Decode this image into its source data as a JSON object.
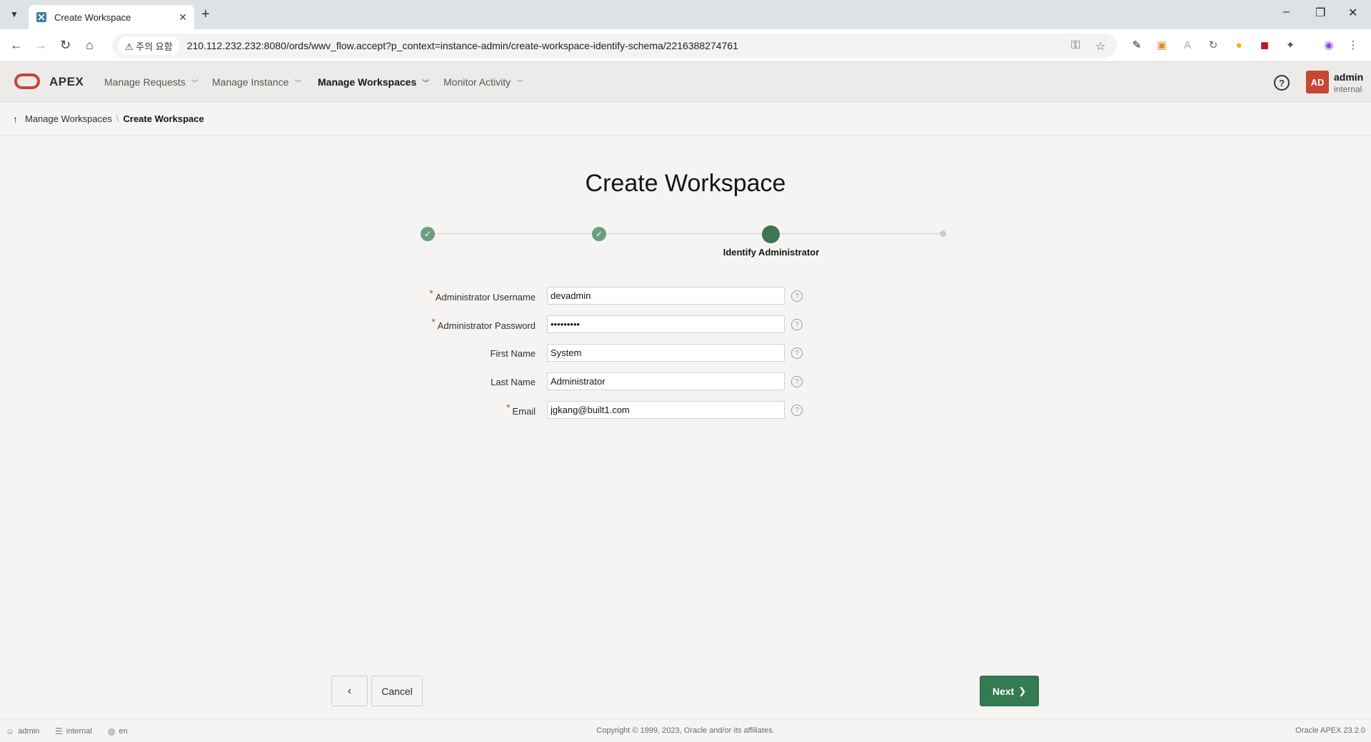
{
  "browser": {
    "tab_title": "Create Workspace",
    "warning_chip": "⚠ 주의 요함",
    "url": "210.112.232.232:8080/ords/wwv_flow.accept?p_context=instance-admin/create-workspace-identify-schema/2216388274761"
  },
  "header": {
    "brand": "APEX",
    "menu": [
      {
        "label": "Manage Requests"
      },
      {
        "label": "Manage Instance"
      },
      {
        "label": "Manage Workspaces"
      },
      {
        "label": "Monitor Activity"
      }
    ],
    "avatar_initials": "AD",
    "user_name": "admin",
    "user_workspace": "internal"
  },
  "breadcrumb": {
    "parent": "Manage Workspaces",
    "current": "Create Workspace"
  },
  "wizard": {
    "title": "Create Workspace",
    "current_step_label": "Identify Administrator"
  },
  "form": {
    "username_label": "Administrator Username",
    "username_value": "devadmin",
    "password_label": "Administrator Password",
    "password_value": "•••••••••",
    "first_name_label": "First Name",
    "first_name_value": "System",
    "last_name_label": "Last Name",
    "last_name_value": "Administrator",
    "email_label": "Email",
    "email_value": "jgkang@built1.com"
  },
  "buttons": {
    "prev": "‹",
    "cancel": "Cancel",
    "next": "Next"
  },
  "footer": {
    "user": "admin",
    "workspace": "internal",
    "language": "en",
    "copyright": "Copyright © 1999, 2023, Oracle and/or its affiliates.",
    "version": "Oracle APEX 23.2.0"
  }
}
